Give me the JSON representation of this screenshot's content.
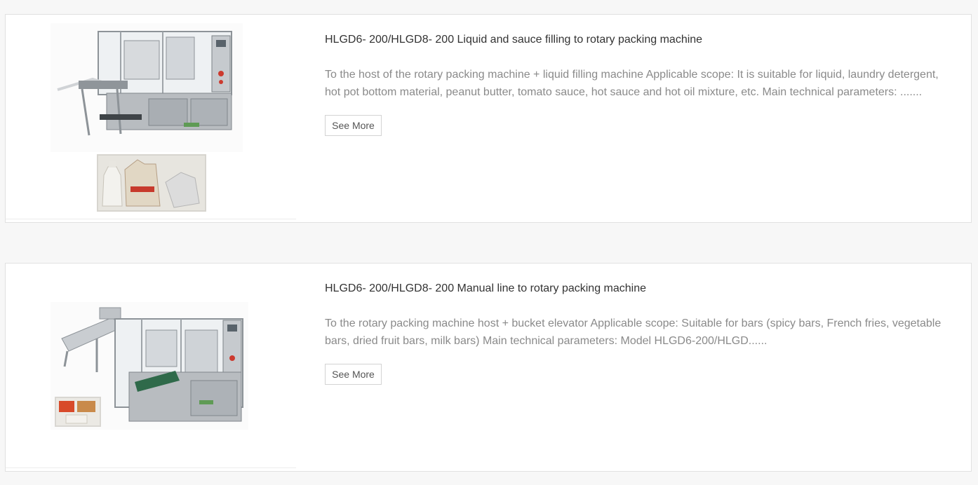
{
  "products": [
    {
      "title": "HLGD6- 200/HLGD8- 200 Liquid and sauce filling to rotary packing machine",
      "description": "To the host of the rotary packing machine + liquid filling machine Applicable scope: It is suitable for liquid, laundry detergent, hot pot bottom material, peanut butter, tomato sauce, hot sauce and hot oil mixture, etc. Main technical parameters: .......",
      "button_label": "See More"
    },
    {
      "title": "HLGD6- 200/HLGD8- 200 Manual line to rotary packing machine",
      "description": "To the rotary packing machine host + bucket elevator Applicable scope: Suitable for bars (spicy bars, French fries, vegetable bars, dried fruit bars, milk bars) Main technical parameters: Model HLGD6-200/HLGD......",
      "button_label": "See More"
    }
  ],
  "colors": {
    "page_bg": "#f7f7f7",
    "card_bg": "#ffffff",
    "card_border": "#e1e1e1",
    "title_text": "#333333",
    "desc_text": "#8a8a8a",
    "machine_steel": "#b8bcc0"
  }
}
